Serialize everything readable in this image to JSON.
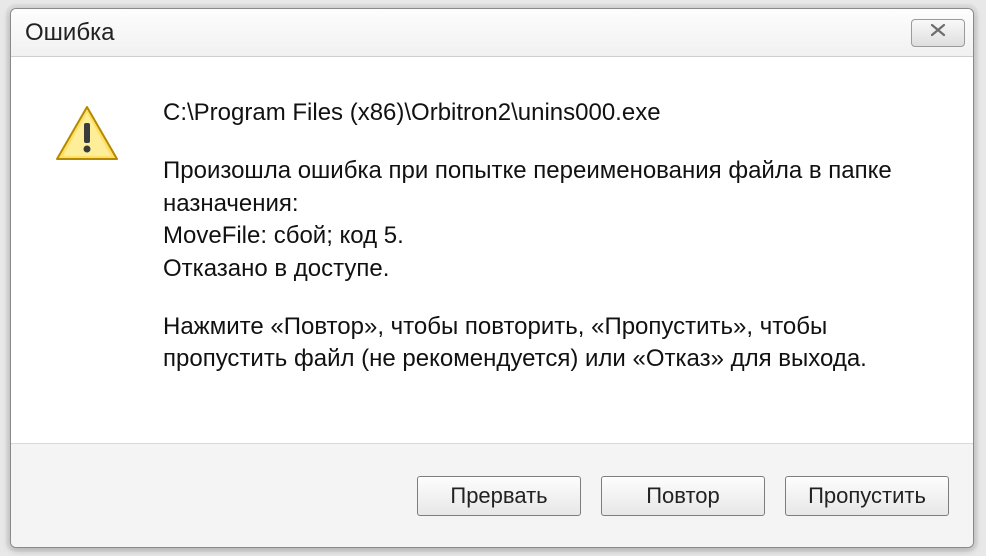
{
  "dialog": {
    "title": "Ошибка",
    "file_path": "C:\\Program Files (x86)\\Orbitron2\\unins000.exe",
    "body": "Произошла ошибка при попытке переименования файла в папке назначения:\nMoveFile: сбой; код 5.\nОтказано в доступе.",
    "hint": "Нажмите «Повтор», чтобы повторить, «Пропустить», чтобы пропустить файл (не рекомендуется) или «Отказ» для выхода.",
    "buttons": {
      "abort": "Прервать",
      "retry": "Повтор",
      "skip": "Пропустить"
    }
  }
}
